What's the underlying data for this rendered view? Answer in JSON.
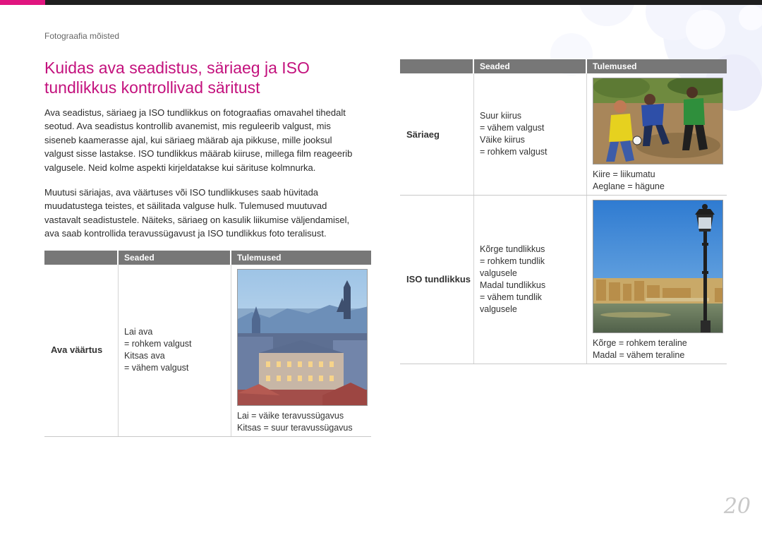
{
  "breadcrumb": "Fotograafia mõisted",
  "title_line1": "Kuidas ava seadistus, säriaeg ja ISO",
  "title_line2": "tundlikkus kontrollivad säritust",
  "para1": [
    "Ava seadistus, säriaeg ja ISO tundlikkus on fotograafias omavahel tihedalt",
    "seotud. Ava seadistus kontrollib avanemist, mis reguleerib valgust, mis",
    "siseneb kaamerasse ajal, kui säriaeg määrab aja pikkuse, mille jooksul",
    "valgust sisse lastakse. ISO tundlikkus määrab kiiruse, millega film reageerib",
    "valgusele. Neid kolme aspekti kirjeldatakse kui särituse kolmnurka."
  ],
  "para2": [
    "Muutusi säriajas, ava väärtuses või ISO tundlikkuses saab hüvitada",
    "muudatustega teistes, et säilitada valguse hulk. Tulemused muutuvad",
    "vastavalt seadistustele. Näiteks, säriaeg on kasulik liikumise väljendamisel,",
    "ava saab kontrollida teravussügavust ja ISO tundlikkus foto teralisust."
  ],
  "headers": {
    "settings": "Seaded",
    "results": "Tulemused"
  },
  "rows": {
    "aperture": {
      "label": "Ava väärtus",
      "settings": [
        "Lai ava",
        "= rohkem valgust",
        "Kitsas ava",
        "= vähem valgust"
      ],
      "results": [
        "Lai = väike teravussügavus",
        "Kitsas = suur teravussügavus"
      ]
    },
    "shutter": {
      "label": "Säriaeg",
      "settings": [
        "Suur kiirus",
        "= vähem valgust",
        "Väike kiirus",
        "= rohkem valgust"
      ],
      "results": [
        "Kiire = liikumatu",
        "Aeglane = hägune"
      ]
    },
    "iso": {
      "label": "ISO tundlikkus",
      "settings": [
        "Kõrge tundlikkus",
        "= rohkem tundlik",
        "valgusele",
        "Madal tundlikkus",
        "= vähem tundlik",
        "valgusele"
      ],
      "results": [
        "Kõrge = rohkem teraline",
        "Madal = vähem teraline"
      ]
    }
  },
  "page_number": "20",
  "colors": {
    "accent": "#c3117d",
    "header_bg": "#777777",
    "topbar": "#1f1f1f"
  }
}
